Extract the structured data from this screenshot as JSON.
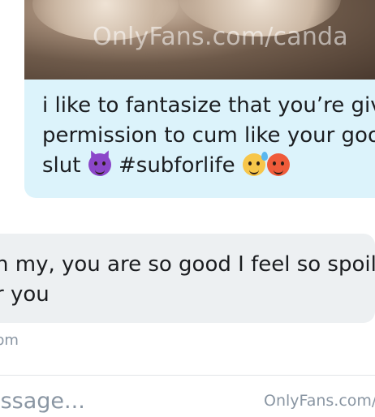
{
  "own_message": {
    "media_watermark": "OnlyFans.com/canda",
    "lines": [
      "i like to fantasize that you’re givi",
      "permission to cum like your goo",
      "slut",
      "#subforlife"
    ],
    "emoji_icons": [
      "smiling-face-with-horns",
      "grinning-face-with-sweat",
      "hot-face"
    ]
  },
  "received_message": {
    "lines": [
      "n my, you are so good I feel so spoile",
      "r you"
    ],
    "time": "pm"
  },
  "composer": {
    "placeholder": "essage..."
  },
  "corner_watermark": "OnlyFans.com/",
  "colors": {
    "own_bubble": "#dcf3fb",
    "received_bubble": "#edf0f2",
    "muted_text": "#8a96a3"
  }
}
